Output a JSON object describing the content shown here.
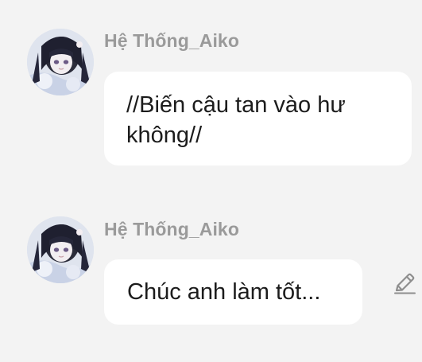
{
  "messages": [
    {
      "sender": "Hệ Thống_Aiko",
      "text": "//Biến cậu tan vào hư không//"
    },
    {
      "sender": "Hệ Thống_Aiko",
      "text": "Chúc anh làm tốt..."
    }
  ],
  "icons": {
    "edit": "pencil-icon"
  },
  "colors": {
    "background": "#f3f3f3",
    "bubble": "#ffffff",
    "sender_name": "#9a9a9a",
    "message_text": "#1c1c1c"
  }
}
